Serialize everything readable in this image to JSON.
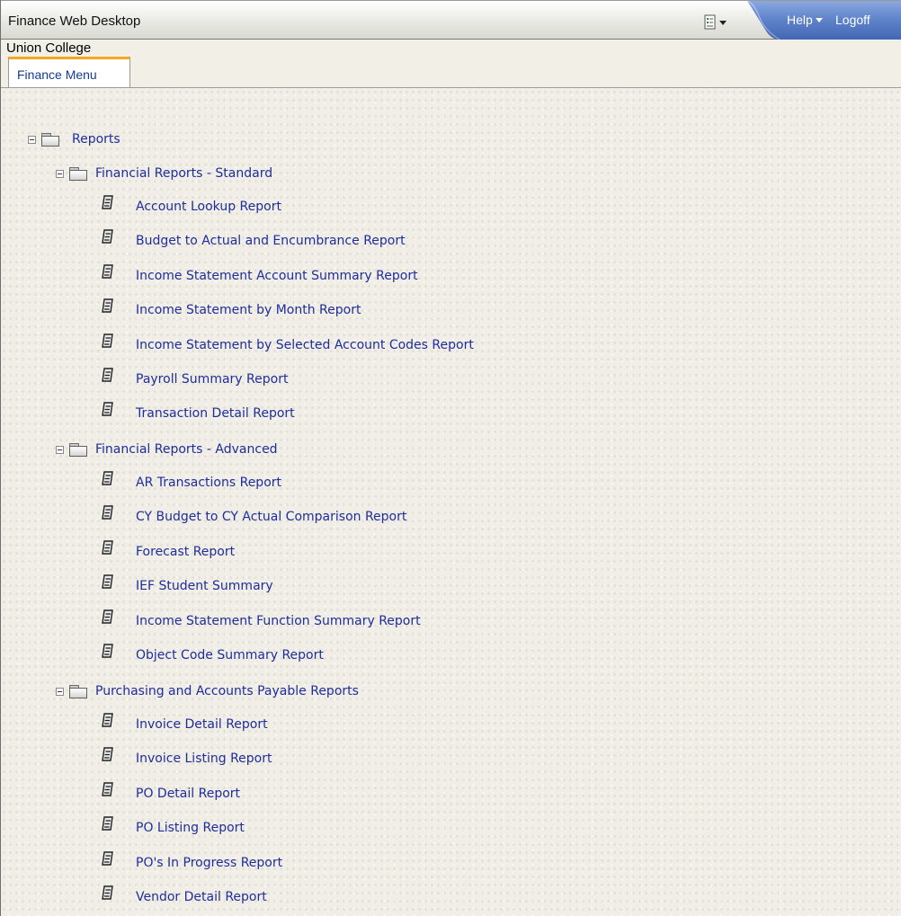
{
  "window": {
    "title": "Finance Web Desktop",
    "help_label": "Help",
    "logoff_label": "Logoff",
    "doc_menu_icon": "document-menu-icon"
  },
  "header": {
    "org_name": "Union College",
    "tabs": [
      {
        "label": "Finance Menu",
        "active": true
      }
    ]
  },
  "colors": {
    "link": "#1f2d9b",
    "tab_accent": "#f5a623",
    "topbar_blue": "#5a7ec6",
    "background": "#f0eee6"
  },
  "tree": {
    "root": {
      "label": "Reports",
      "expanded": true
    },
    "groups": [
      {
        "label": "Financial Reports - Standard",
        "expanded": true,
        "items": [
          "Account Lookup Report",
          "Budget to Actual and Encumbrance Report",
          "Income Statement Account Summary Report",
          "Income Statement by Month Report",
          "Income Statement by Selected Account Codes Report",
          "Payroll Summary Report",
          "Transaction Detail Report"
        ]
      },
      {
        "label": "Financial Reports - Advanced",
        "expanded": true,
        "items": [
          "AR Transactions Report",
          "CY Budget to CY Actual Comparison Report",
          "Forecast Report",
          "IEF Student Summary",
          "Income Statement Function Summary Report",
          "Object Code Summary Report"
        ]
      },
      {
        "label": "Purchasing and Accounts Payable Reports",
        "expanded": true,
        "items": [
          "Invoice Detail Report",
          "Invoice Listing Report",
          "PO Detail Report",
          "PO Listing Report",
          "PO's In Progress Report",
          "Vendor Detail Report"
        ]
      }
    ]
  }
}
